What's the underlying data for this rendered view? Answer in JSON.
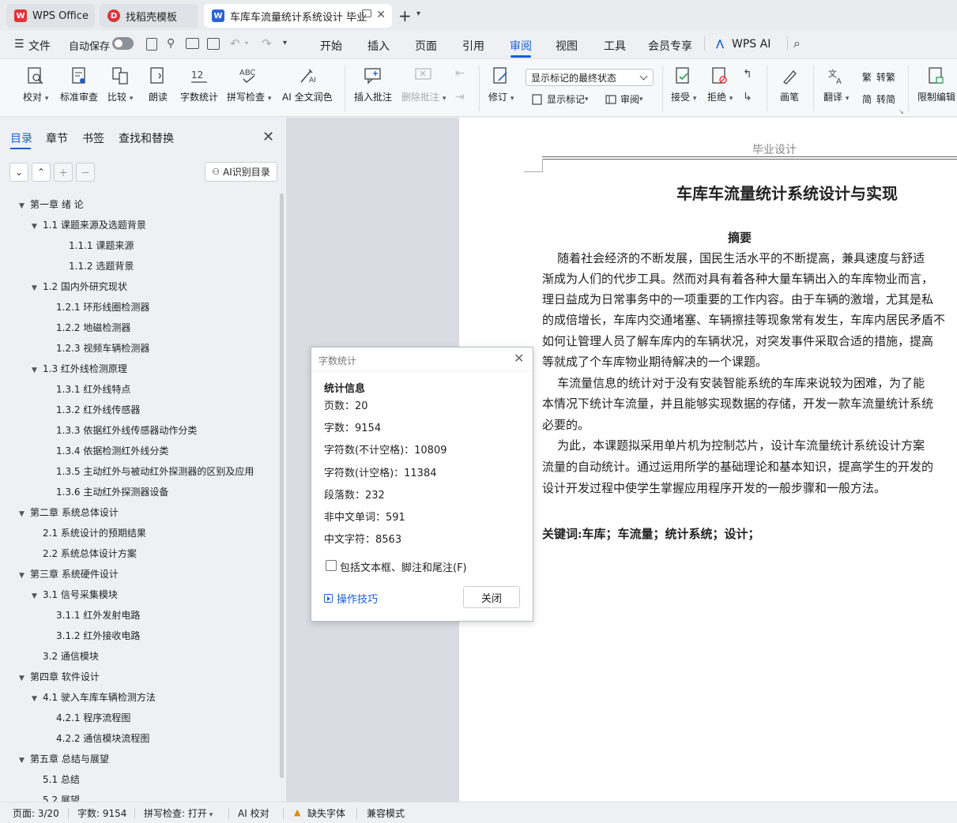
{
  "titlebar": {
    "tabs": [
      {
        "label": "WPS Office",
        "icon": "wps-logo-icon",
        "state": "inactive"
      },
      {
        "label": "找稻壳模板",
        "icon": "docer-logo-icon",
        "state": "inactive"
      },
      {
        "label": "车库车流量统计系统设计 毕业",
        "icon": "writer-doc-icon",
        "state": "active"
      }
    ],
    "new_tab": "+"
  },
  "menubar": {
    "file": "文件",
    "autosave": "自动保存",
    "tabs": [
      "开始",
      "插入",
      "页面",
      "引用",
      "审阅",
      "视图",
      "工具",
      "会员专享"
    ],
    "active_tab": "审阅",
    "wps_ai": "WPS AI"
  },
  "ribbon": {
    "proofread": "校对",
    "standard_review": "标准审查",
    "compare": "比较",
    "read_aloud": "朗读",
    "word_count": "字数统计",
    "spell_check": "拼写检查",
    "ai_polish": "AI 全文润色",
    "insert_comment": "插入批注",
    "delete_comment": "删除批注",
    "revise": "修订",
    "markup_select": "显示标记的最终状态",
    "show_markup": "显示标记",
    "review_pane": "审阅",
    "accept": "接受",
    "reject": "拒绝",
    "ink": "画笔",
    "translate": "翻译",
    "to_traditional": "转繁",
    "to_simplified": "转简",
    "restrict_edit": "限制编辑"
  },
  "nav": {
    "tabs": [
      "目录",
      "章节",
      "书签",
      "查找和替换"
    ],
    "ai_toc": "AI识别目录",
    "toc": [
      {
        "label": "第一章  绪    论",
        "level": 0,
        "arrow": true
      },
      {
        "label": "1.1  课题来源及选题背景",
        "level": 1,
        "arrow": true
      },
      {
        "label": "1.1.1 课题来源",
        "level": 3,
        "arrow": false
      },
      {
        "label": "1.1.2  选题背景",
        "level": 3,
        "arrow": false
      },
      {
        "label": "1.2  国内外研究现状",
        "level": 1,
        "arrow": true
      },
      {
        "label": "1.2.1 环形线圈检测器",
        "level": 2,
        "arrow": false
      },
      {
        "label": "1.2.2 地磁检测器",
        "level": 2,
        "arrow": false
      },
      {
        "label": "1.2.3 视频车辆检测器",
        "level": 2,
        "arrow": false
      },
      {
        "label": "1.3 红外线检测原理",
        "level": 1,
        "arrow": true
      },
      {
        "label": "1.3.1 红外线特点",
        "level": 2,
        "arrow": false
      },
      {
        "label": "1.3.2 红外线传感器",
        "level": 2,
        "arrow": false
      },
      {
        "label": "1.3.3 依据红外线传感器动作分类",
        "level": 2,
        "arrow": false
      },
      {
        "label": "1.3.4 依据检测红外线分类",
        "level": 2,
        "arrow": false
      },
      {
        "label": "1.3.5 主动红外与被动红外探测器的区别及应用",
        "level": 2,
        "arrow": false
      },
      {
        "label": "1.3.6 主动红外探测器设备",
        "level": 2,
        "arrow": false
      },
      {
        "label": "第二章  系统总体设计",
        "level": 0,
        "arrow": true
      },
      {
        "label": "2.1 系统设计的预期结果",
        "level": 1,
        "arrow": false
      },
      {
        "label": "2.2 系统总体设计方案",
        "level": 1,
        "arrow": false
      },
      {
        "label": "第三章  系统硬件设计",
        "level": 0,
        "arrow": true
      },
      {
        "label": "3.1 信号采集模块",
        "level": 1,
        "arrow": true
      },
      {
        "label": "3.1.1 红外发射电路",
        "level": 2,
        "arrow": false
      },
      {
        "label": "3.1.2  红外接收电路",
        "level": 2,
        "arrow": false
      },
      {
        "label": "3.2 通信模块",
        "level": 1,
        "arrow": false
      },
      {
        "label": "第四章  软件设计",
        "level": 0,
        "arrow": true
      },
      {
        "label": "4.1 驶入车库车辆检测方法",
        "level": 1,
        "arrow": true
      },
      {
        "label": "4.2.1 程序流程图",
        "level": 2,
        "arrow": false
      },
      {
        "label": "4.2.2  通信模块流程图",
        "level": 2,
        "arrow": false
      },
      {
        "label": "第五章  总结与展望",
        "level": 0,
        "arrow": true
      },
      {
        "label": "5.1  总结",
        "level": 1,
        "arrow": false
      },
      {
        "label": "5.2  展望",
        "level": 1,
        "arrow": false
      }
    ]
  },
  "document": {
    "header": "毕业设计",
    "title": "车库车流量统计系统设计与实现",
    "abstract_heading": "摘要",
    "lines": [
      "    随着社会经济的不断发展，国民生活水平的不断提高，兼具速度与舒适",
      "渐成为人们的代步工具。然而对具有着各种大量车辆出入的车库物业而言，",
      "理日益成为日常事务中的一项重要的工作内容。由于车辆的激增，尤其是私",
      "的成倍增长，车库内交通堵塞、车辆擦挂等现象常有发生，车库内居民矛盾不",
      "如何让管理人员了解车库内的车辆状况，对突发事件采取合适的措施，提高",
      "等就成了个车库物业期待解决的一个课题。",
      "    车流量信息的统计对于没有安装智能系统的车库来说较为困难，为了能",
      "本情况下统计车流量，并且能够实现数据的存储，开发一款车流量统计系统",
      "必要的。",
      "    为此，本课题拟采用单片机为控制芯片，设计车流量统计系统设计方案",
      "流量的自动统计。通过运用所学的基础理论和基本知识，提高学生的开发的",
      "设计开发过程中使学生掌握应用程序开发的一般步骤和一般方法。"
    ],
    "keywords": "关键词:车库；车流量；统计系统；设计；"
  },
  "dialog": {
    "title": "字数统计",
    "section": "统计信息",
    "stats": [
      "页数：20",
      "字数：9154",
      "字符数(不计空格)：10809",
      "字符数(计空格)：11384",
      "段落数：232",
      "非中文单词：591",
      "中文字符：8563"
    ],
    "checkbox_label": "包括文本框、脚注和尾注(F)",
    "tips": "操作技巧",
    "close": "关闭"
  },
  "statusbar": {
    "page": "页面: 3/20",
    "word_count": "字数: 9154",
    "spell": "拼写检查: 打开",
    "ai_proof": "AI 校对",
    "missing_font": "缺失字体",
    "compat": "兼容模式"
  },
  "colors": {
    "accent": "#1a5fd6",
    "wps_red": "#e0333a",
    "writer_blue": "#2a62d8"
  }
}
